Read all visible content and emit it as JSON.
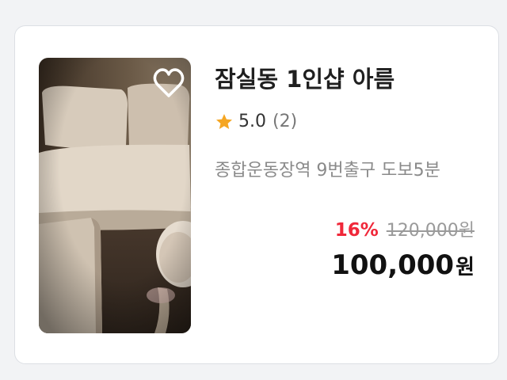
{
  "listing": {
    "title": "잠실동 1인샵 아름",
    "rating": {
      "score": "5.0",
      "count": "(2)",
      "icon": "star-icon",
      "star_color": "#f5a623"
    },
    "location": "종합운동장역 9번출구 도보5분",
    "discount_percent": "16%",
    "original_price": "120,000원",
    "price": "100,000",
    "price_unit": "원",
    "favorite_icon": "heart-outline-icon",
    "colors": {
      "discount": "#f0283a",
      "original_price": "#9a9a9a",
      "price": "#111111"
    }
  }
}
